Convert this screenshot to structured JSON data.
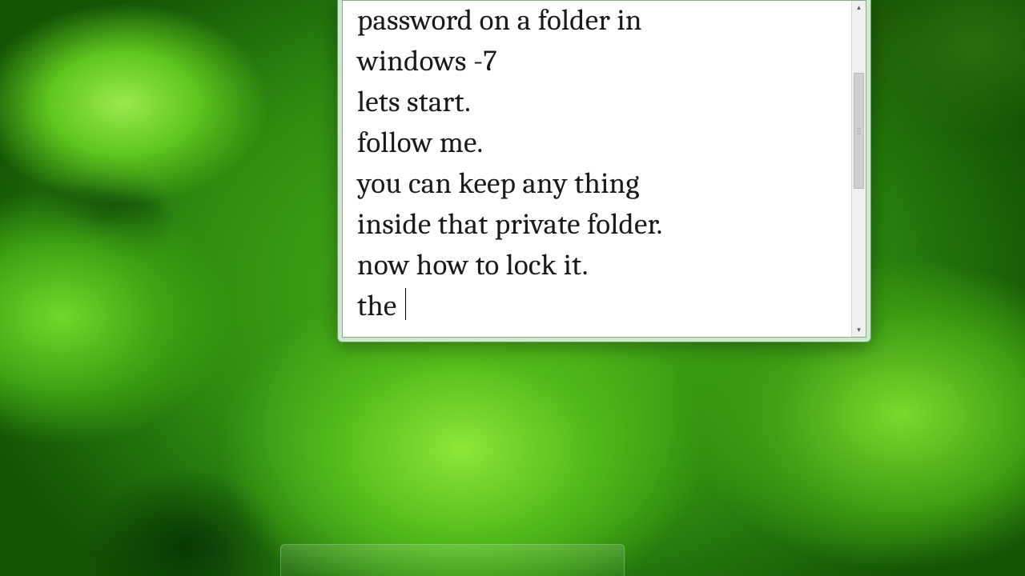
{
  "editor": {
    "lines": [
      "password on a folder in",
      "windows -7",
      "lets start.",
      "follow me.",
      "you can keep any thing",
      "inside that private folder.",
      "now how to lock it.",
      "the "
    ]
  },
  "scrollbar": {
    "up_glyph": "▴",
    "down_glyph": "▾"
  }
}
